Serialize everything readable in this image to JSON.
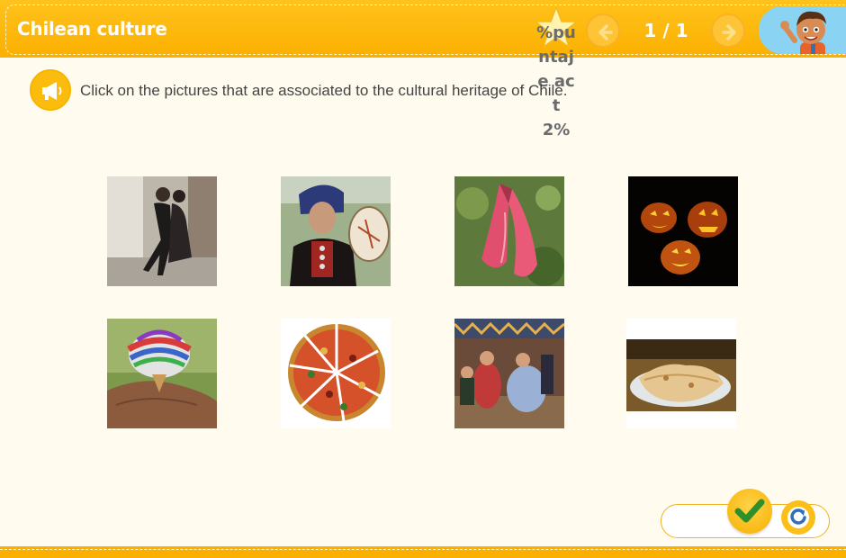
{
  "header": {
    "title": "Chilean culture",
    "score_text": "%puntaje act 2%",
    "page_counter": "1 / 1"
  },
  "instruction": {
    "text": "Click on the pictures that are associated to the cultural heritage of Chile."
  },
  "pictures": [
    {
      "name": "tango-dancers"
    },
    {
      "name": "mapuche-woman-with-drum"
    },
    {
      "name": "copihue-flower"
    },
    {
      "name": "halloween-pumpkins"
    },
    {
      "name": "spinning-top"
    },
    {
      "name": "pizza"
    },
    {
      "name": "cueca-fiesta-painting"
    },
    {
      "name": "empanadas"
    }
  ],
  "colors": {
    "header": "#fbb000",
    "background": "#fffbef",
    "accent_blue": "#8ad3f2",
    "button_yellow": "#fcbc0e"
  }
}
